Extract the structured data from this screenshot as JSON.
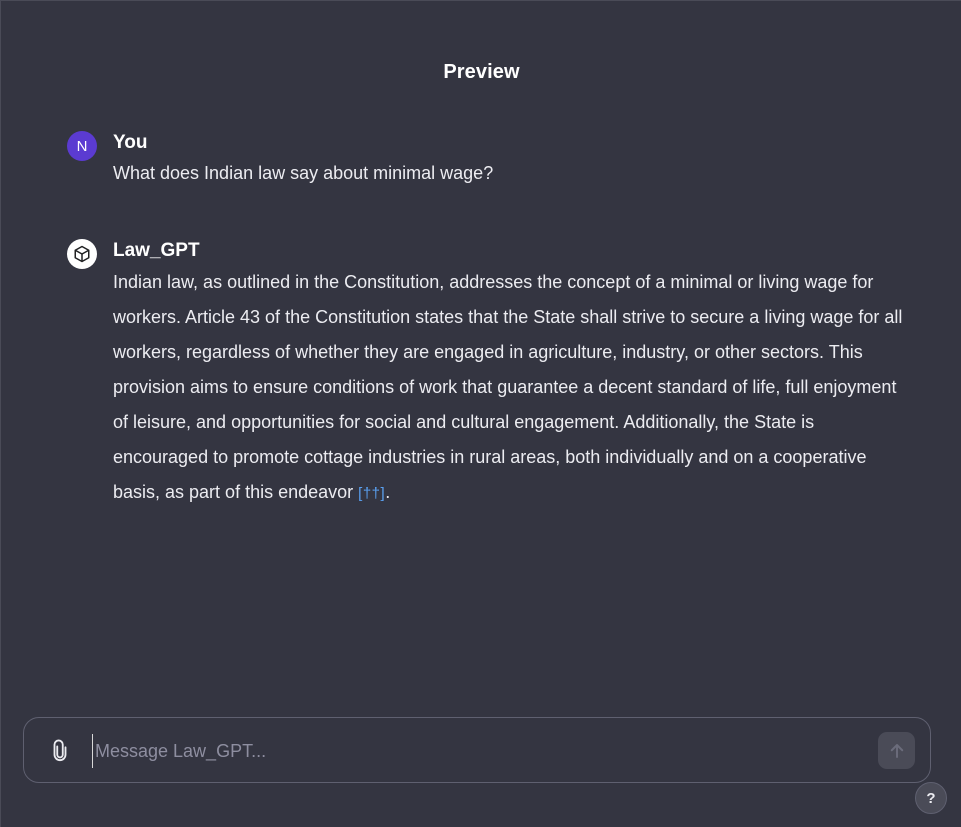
{
  "header": {
    "title": "Preview"
  },
  "conversation": {
    "user_message": {
      "avatar_initial": "N",
      "author": "You",
      "text": "What does Indian law say about minimal wage?"
    },
    "assistant_message": {
      "avatar_icon": "cube-icon",
      "author": "Law_GPT",
      "text": "Indian law, as outlined in the Constitution, addresses the concept of a minimal or living wage for workers. Article 43 of the Constitution states that the State shall strive to secure a living wage for all workers, regardless of whether they are engaged in agriculture, industry, or other sectors. This provision aims to ensure conditions of work that guarantee a decent standard of life, full enjoyment of leisure, and opportunities for social and cultural engagement. Additionally, the State is encouraged to promote cottage industries in rural areas, both individually and on a cooperative basis, as part of this endeavor",
      "citation": "[††]",
      "trailing_punctuation": "."
    }
  },
  "composer": {
    "placeholder": "Message Law_GPT...",
    "value": "",
    "attach_icon": "paperclip-icon",
    "send_icon": "arrow-up-icon"
  },
  "help": {
    "label": "?"
  },
  "colors": {
    "background": "#343541",
    "user_avatar": "#5b3bd1",
    "citation": "#5aa0f0",
    "send_button": "#4a4b57"
  }
}
